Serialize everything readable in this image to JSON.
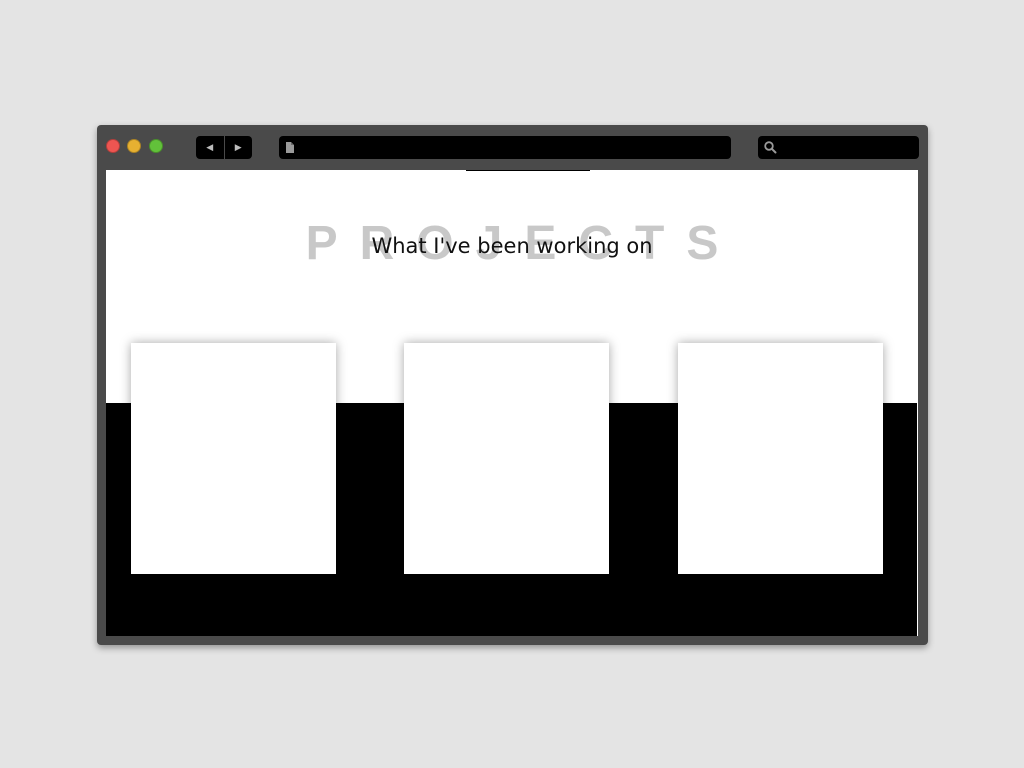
{
  "window": {
    "nav": {
      "back_glyph": "◀",
      "forward_glyph": "▶"
    },
    "address_icon": "document-icon",
    "search_icon": "search-icon",
    "traffic_lights": {
      "close_color": "#ee5551",
      "minimize_color": "#e7b031",
      "maximize_color": "#62c13a"
    }
  },
  "page": {
    "heading": "PROJECTS",
    "subtitle": "What I've been working on",
    "cards": [
      {
        "name": "project-card-1"
      },
      {
        "name": "project-card-2"
      },
      {
        "name": "project-card-3"
      }
    ]
  },
  "colors": {
    "chrome": "#4a4a4a",
    "background": "#e4e4e4",
    "heading": "#c8c8c8"
  }
}
